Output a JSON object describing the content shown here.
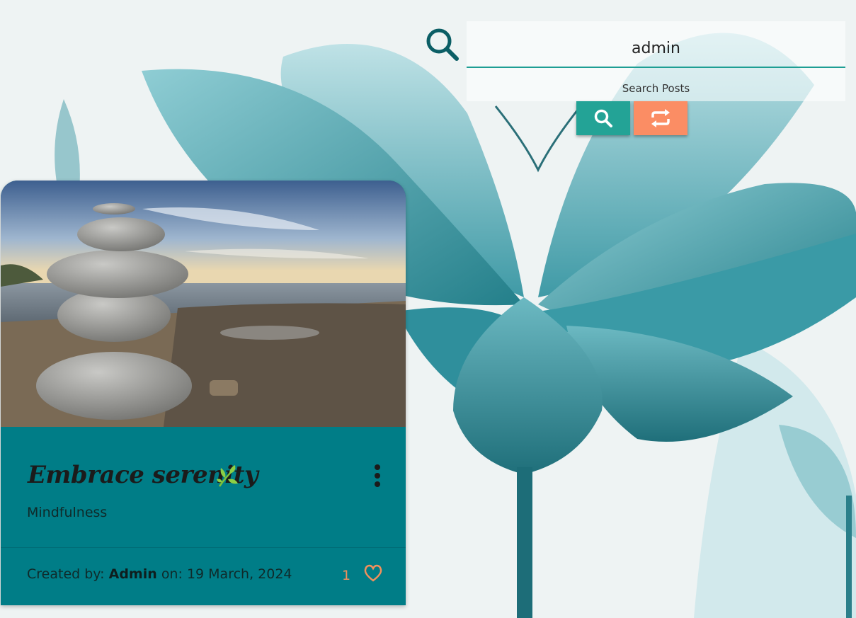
{
  "search": {
    "value": "admin",
    "label": "Search Posts",
    "icon": "search-icon",
    "search_button_icon": "search-icon",
    "reset_button_icon": "repeat-icon"
  },
  "post": {
    "title": "Embrace serenity",
    "title_icon": "leaf-icon",
    "category": "Mindfulness",
    "created_by_label": "Created by:",
    "author": "Admin",
    "on_label": "on:",
    "date": "19 March, 2024",
    "likes": "1",
    "like_icon": "heart-icon",
    "menu_icon": "vertical-dots-icon"
  },
  "colors": {
    "accent": "#23a396",
    "reset": "#fb8d64",
    "card": "#007d87",
    "like": "#f3905c"
  }
}
